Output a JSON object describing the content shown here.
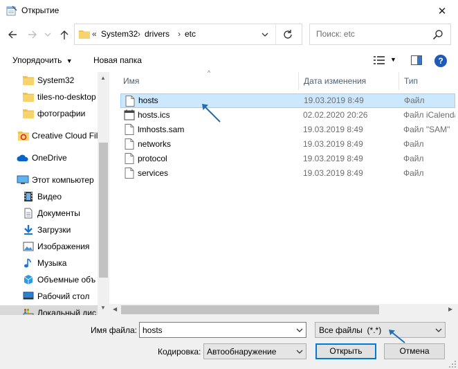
{
  "window": {
    "title": "Открытие",
    "close_glyph": "✕"
  },
  "nav": {
    "breadcrumb_overflow": "«",
    "breadcrumb": [
      "System32",
      "drivers",
      "etc"
    ],
    "breadcrumb_sep": "›",
    "search_placeholder": "Поиск: etc"
  },
  "toolbar": {
    "organize_label": "Упорядочить",
    "new_folder_label": "Новая папка",
    "help_glyph": "?"
  },
  "sidebar": {
    "items": [
      {
        "label": "System32",
        "icon": "folder-icon"
      },
      {
        "label": "tiles-no-desktop",
        "icon": "folder-icon"
      },
      {
        "label": "фотографии",
        "icon": "folder-icon"
      },
      {
        "label": "Creative Cloud Fil",
        "icon": "creative-cloud-icon"
      },
      {
        "label": "OneDrive",
        "icon": "onedrive-icon"
      },
      {
        "label": "Этот компьютер",
        "icon": "computer-icon"
      },
      {
        "label": "Видео",
        "icon": "video-icon"
      },
      {
        "label": "Документы",
        "icon": "documents-icon"
      },
      {
        "label": "Загрузки",
        "icon": "downloads-icon"
      },
      {
        "label": "Изображения",
        "icon": "pictures-icon"
      },
      {
        "label": "Музыка",
        "icon": "music-icon"
      },
      {
        "label": "Объемные объ",
        "icon": "3d-objects-icon"
      },
      {
        "label": "Рабочий стол",
        "icon": "desktop-icon"
      },
      {
        "label": "Локальный дис",
        "icon": "local-disk-icon"
      }
    ]
  },
  "list": {
    "columns": {
      "name": "Имя",
      "date": "Дата изменения",
      "type": "Тип"
    },
    "rows": [
      {
        "name": "hosts",
        "date": "19.03.2019 8:49",
        "type": "Файл",
        "icon": "file-icon"
      },
      {
        "name": "hosts.ics",
        "date": "02.02.2020 20:26",
        "type": "Файл iCalenda",
        "icon": "calendar-file-icon"
      },
      {
        "name": "lmhosts.sam",
        "date": "19.03.2019 8:49",
        "type": "Файл \"SAM\"",
        "icon": "file-icon"
      },
      {
        "name": "networks",
        "date": "19.03.2019 8:49",
        "type": "Файл",
        "icon": "file-icon"
      },
      {
        "name": "protocol",
        "date": "19.03.2019 8:49",
        "type": "Файл",
        "icon": "file-icon"
      },
      {
        "name": "services",
        "date": "19.03.2019 8:49",
        "type": "Файл",
        "icon": "file-icon"
      }
    ],
    "selected_index": 0
  },
  "bottom": {
    "filename_label": "Имя файла:",
    "filename_value": "hosts",
    "filter_value": "Все файлы  (*.*)",
    "encoding_label": "Кодировка:",
    "encoding_value": "Автообнаружение",
    "open_label": "Открыть",
    "cancel_label": "Отмена"
  },
  "colors": {
    "selection_bg": "#cce8ff",
    "selection_border": "#99d1ff",
    "accent": "#0078d7",
    "annotation_arrow": "#1e6fb4"
  }
}
